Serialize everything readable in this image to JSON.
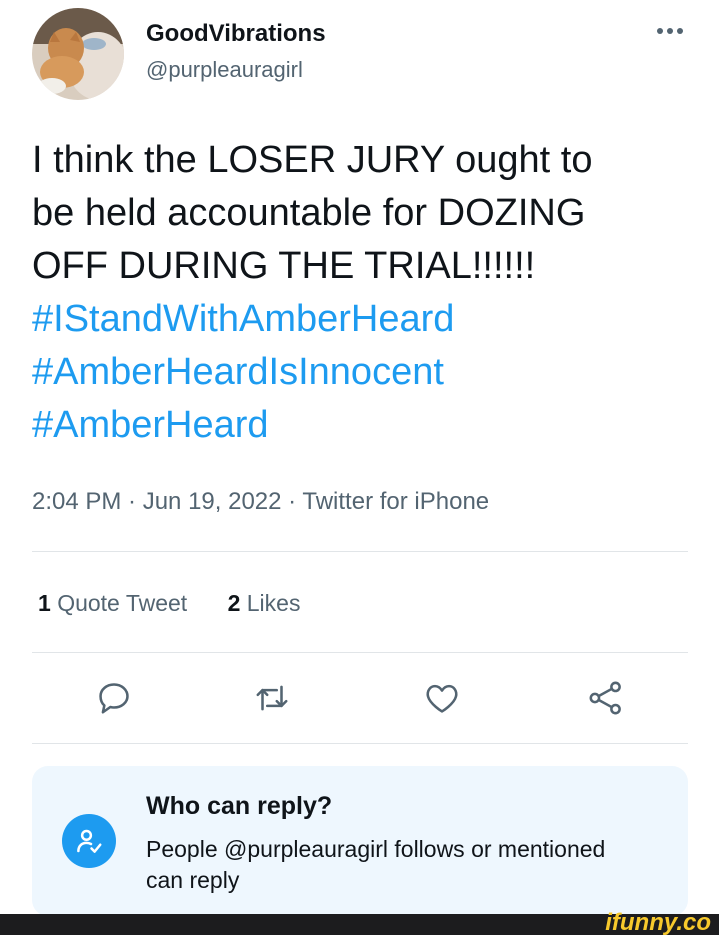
{
  "user": {
    "display_name": "GoodVibrations",
    "handle": "@purpleauragirl"
  },
  "tweet": {
    "text_lines": [
      "I think the LOSER JURY ought to",
      "be held accountable for DOZING",
      "OFF DURING THE TRIAL!!!!!!"
    ],
    "hashtags": [
      "#IStandWithAmberHeard",
      "#AmberHeardIsInnocent",
      "#AmberHeard"
    ],
    "meta": "2:04 PM · Jun 19, 2022 · Twitter for iPhone"
  },
  "stats": {
    "quote_count": "1",
    "quote_label": "Quote Tweet",
    "like_count": "2",
    "like_label": "Likes"
  },
  "actions": [
    "reply-icon",
    "retweet-icon",
    "like-icon",
    "share-icon"
  ],
  "reply_settings": {
    "title": "Who can reply?",
    "description": "People @purpleauragirl follows or mentioned can reply"
  },
  "watermark": "ifunny.co",
  "colors": {
    "link": "#1d9bf0",
    "secondary_text": "#536471",
    "reply_box_bg": "#eef7fe",
    "watermark": "#f7c92c"
  }
}
